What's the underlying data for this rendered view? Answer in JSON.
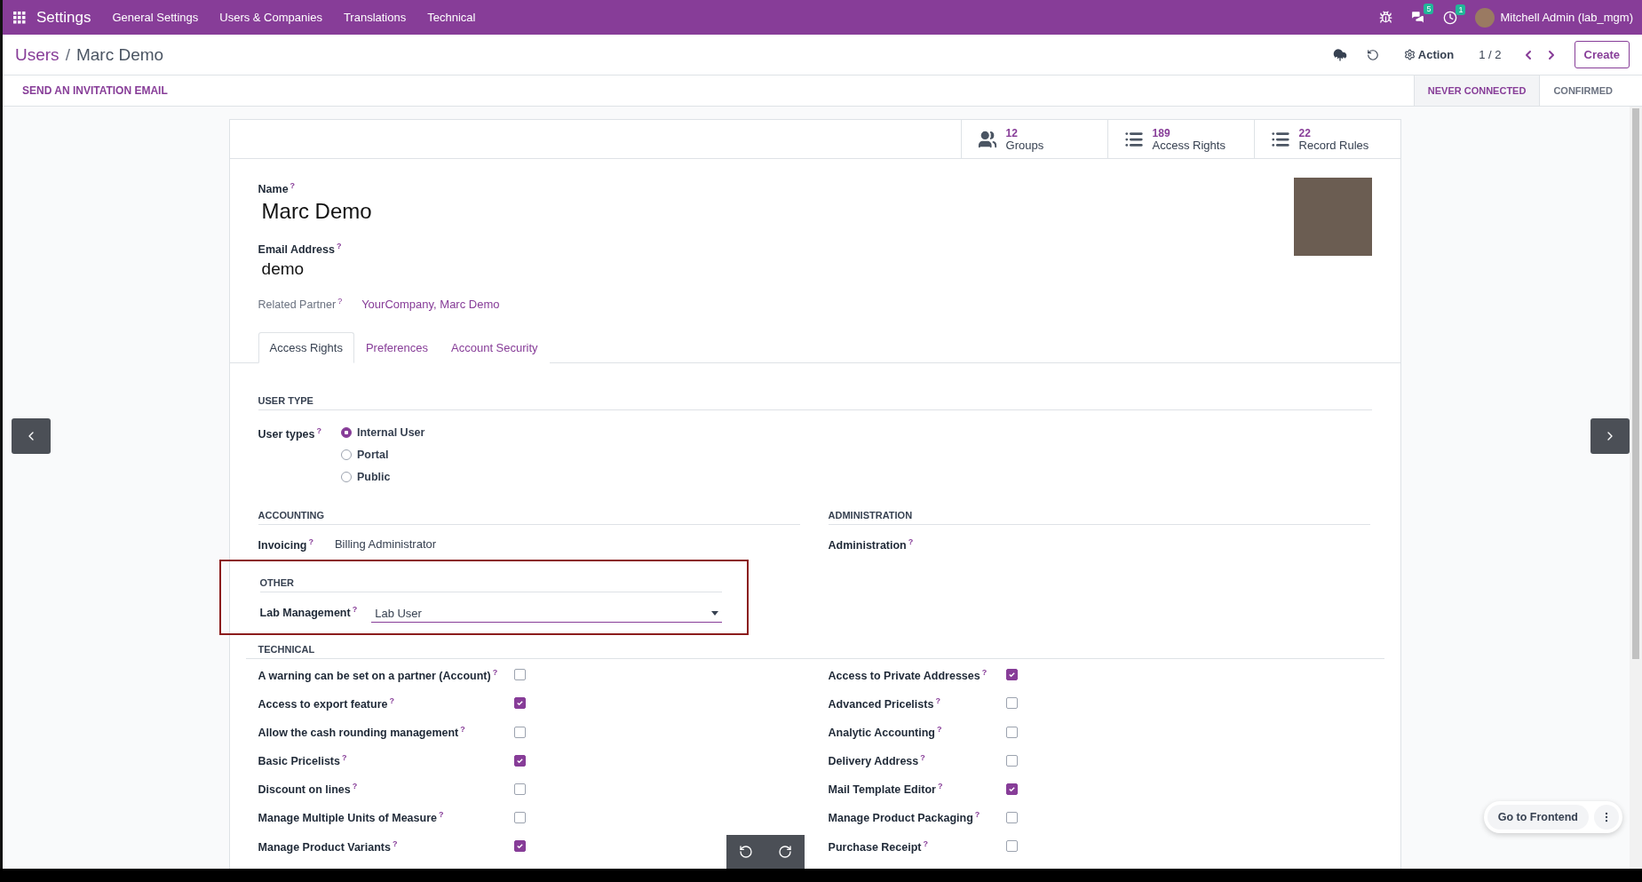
{
  "navbar": {
    "app": "Settings",
    "menus": [
      {
        "label": "General Settings"
      },
      {
        "label": "Users & Companies"
      },
      {
        "label": "Translations"
      },
      {
        "label": "Technical"
      }
    ],
    "chat_badge": "5",
    "activity_badge": "1",
    "user": "Mitchell Admin (lab_mgm)"
  },
  "control_panel": {
    "separator": "/",
    "breadcrumbs": [
      {
        "label": "Users",
        "kind": "link"
      },
      {
        "label": "Marc Demo",
        "kind": "current"
      }
    ],
    "action": "Action",
    "pager": "1 / 2",
    "create": "Create"
  },
  "status_bar": {
    "button": "SEND AN INVITATION EMAIL",
    "stages": [
      {
        "label": "NEVER CONNECTED",
        "selected": true
      },
      {
        "label": "CONFIRMED",
        "selected": false
      }
    ]
  },
  "stat_buttons": [
    {
      "count": "12",
      "label": "Groups",
      "kind": "users"
    },
    {
      "count": "189",
      "label": "Access Rights",
      "kind": "list"
    },
    {
      "count": "22",
      "label": "Record Rules",
      "kind": "list"
    }
  ],
  "form": {
    "name_label": "Name$^{?}$",
    "name": "Marc Demo",
    "email_label": "Email Address$^{?}$",
    "email": "demo",
    "related_partner_label": "Related Partner$^{?}$",
    "related_partner": "YourCompany, Marc Demo"
  },
  "tabs": [
    {
      "label": "Access Rights",
      "selected": true
    },
    {
      "label": "Preferences",
      "selected": false
    },
    {
      "label": "Account Security",
      "selected": false
    }
  ],
  "user_type": {
    "title": "USER TYPE",
    "label": "User types$^{?}$",
    "options": [
      {
        "label": "Internal User",
        "selected": true
      },
      {
        "label": "Portal",
        "selected": false
      },
      {
        "label": "Public",
        "selected": false
      }
    ]
  },
  "accounting": {
    "title": "ACCOUNTING",
    "label": "Invoicing$^{?}$",
    "value": "Billing Administrator"
  },
  "administration": {
    "title": "ADMINISTRATION",
    "label": "Administration$^{?}$"
  },
  "other": {
    "title": "OTHER",
    "label": "Lab Management$^{?}$",
    "value": "Lab User",
    "highlighted": true
  },
  "technical": {
    "title": "TECHNICAL",
    "left": [
      {
        "label": "A warning can be set on a partner (Account)$^{?}$",
        "checked": false
      },
      {
        "label": "Access to export feature$^{?}$",
        "checked": true
      },
      {
        "label": "Allow the cash rounding management$^{?}$",
        "checked": false
      },
      {
        "label": "Basic Pricelists$^{?}$",
        "checked": true
      },
      {
        "label": "Discount on lines$^{?}$",
        "checked": false
      },
      {
        "label": "Manage Multiple Units of Measure$^{?}$",
        "checked": false
      },
      {
        "label": "Manage Product Variants$^{?}$",
        "checked": true
      }
    ],
    "right": [
      {
        "label": "Access to Private Addresses$^{?}$",
        "checked": true
      },
      {
        "label": "Advanced Pricelists$^{?}$",
        "checked": false
      },
      {
        "label": "Analytic Accounting$^{?}$",
        "checked": false
      },
      {
        "label": "Delivery Address$^{?}$",
        "checked": false
      },
      {
        "label": "Mail Template Editor$^{?}$",
        "checked": true
      },
      {
        "label": "Manage Product Packaging$^{?}$",
        "checked": false
      },
      {
        "label": "Purchase Receipt$^{?}$",
        "checked": false
      }
    ]
  },
  "frontend_button": "Go to Frontend"
}
